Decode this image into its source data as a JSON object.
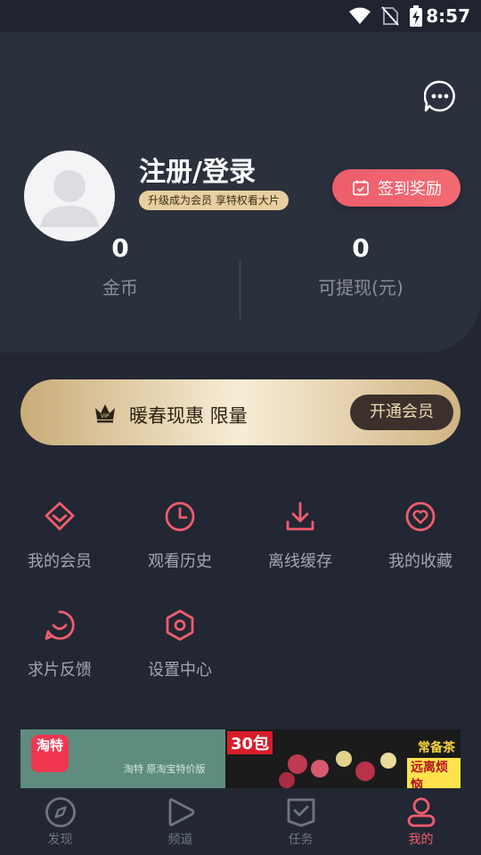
{
  "status_bar": {
    "time": "8:57"
  },
  "profile": {
    "login_title": "注册/登录",
    "vip_hint": "升级成为会员 享特权看大片",
    "checkin_label": "签到奖励"
  },
  "stats": [
    {
      "value": "0",
      "label": "金币"
    },
    {
      "value": "0",
      "label": "可提现(元)"
    }
  ],
  "vip_banner": {
    "promo_text": "暖春现惠 限量",
    "button_label": "开通会员"
  },
  "menu": [
    {
      "label": "我的会员",
      "icon": "diamond-icon"
    },
    {
      "label": "观看历史",
      "icon": "clock-icon"
    },
    {
      "label": "离线缓存",
      "icon": "download-icon"
    },
    {
      "label": "我的收藏",
      "icon": "heart-icon"
    },
    {
      "label": "求片反馈",
      "icon": "smile-chat-icon"
    },
    {
      "label": "设置中心",
      "icon": "hexagon-settings-icon"
    }
  ],
  "ad": {
    "app_name": "淘特",
    "tagline": "淘特 原淘宝特价版",
    "pack_count": "30包",
    "product_tag": "常备茶",
    "product_slogan": "远离烦恼"
  },
  "tabs": [
    {
      "label": "发现",
      "icon": "compass-icon",
      "active": false
    },
    {
      "label": "频道",
      "icon": "play-icon",
      "active": false
    },
    {
      "label": "任务",
      "icon": "task-check-icon",
      "active": false
    },
    {
      "label": "我的",
      "icon": "user-icon",
      "active": true
    }
  ],
  "colors": {
    "accent": "#f05d6d",
    "background": "#222733",
    "header_bg": "#2b303d",
    "gold": "#e7cf9f"
  }
}
